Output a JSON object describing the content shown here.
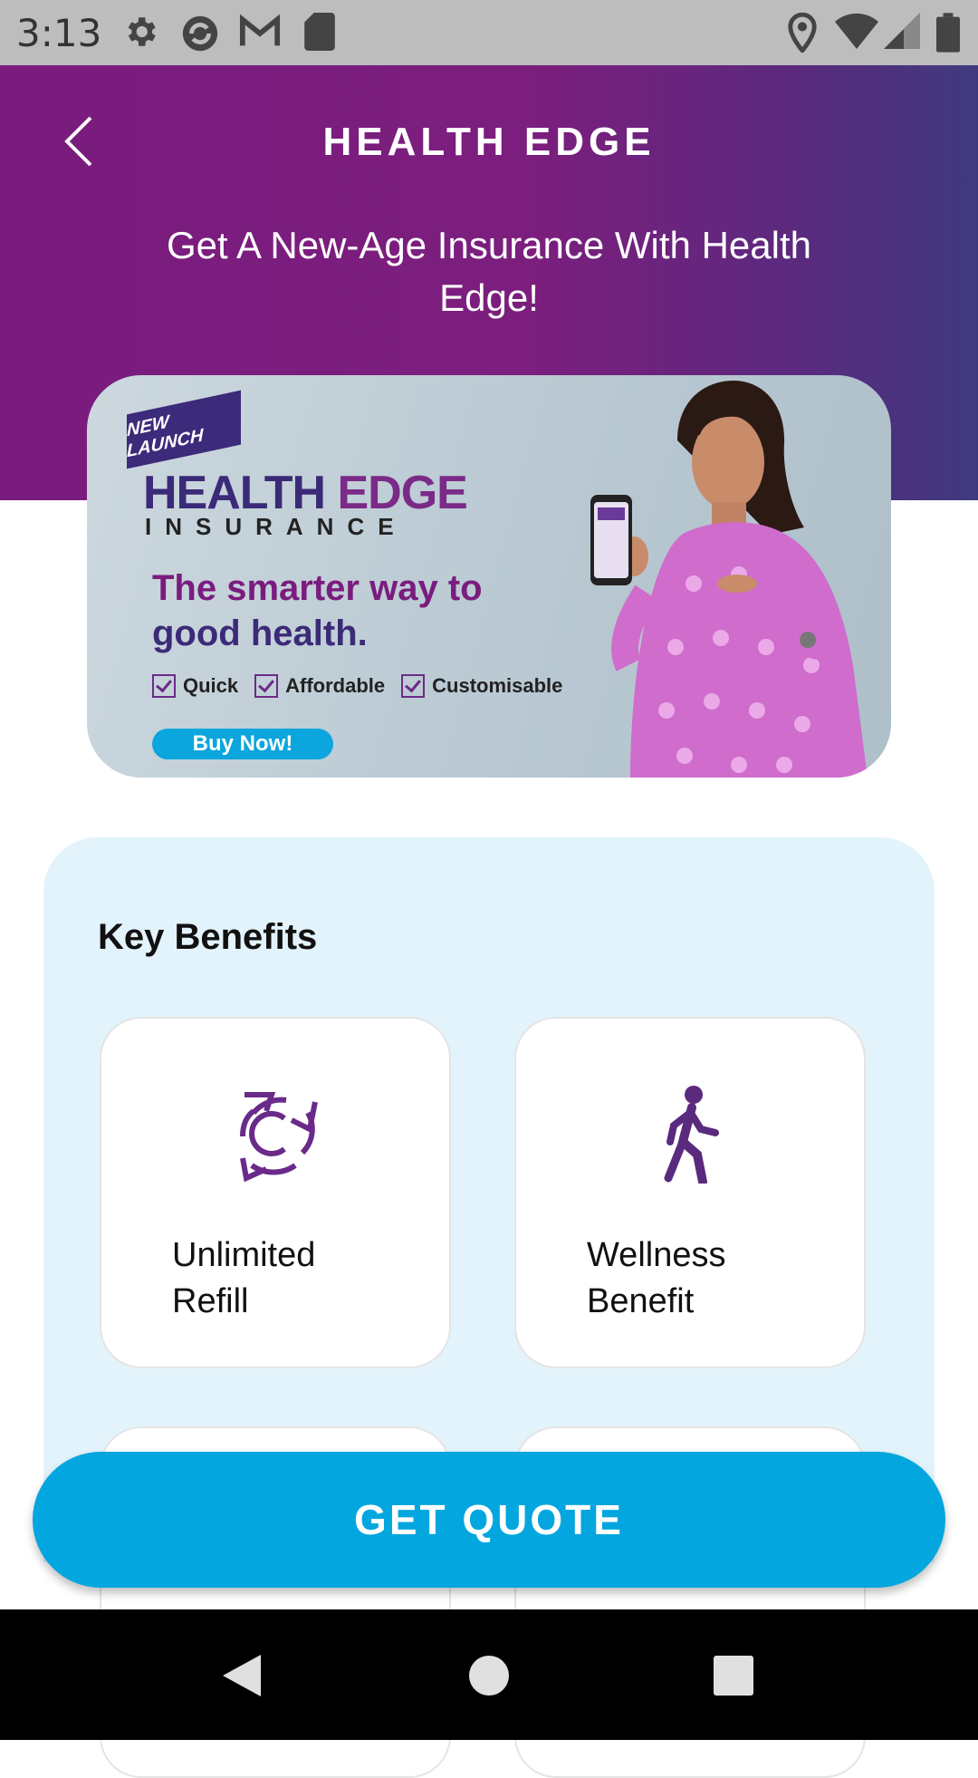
{
  "status_bar": {
    "time": "3:13",
    "left_icons": [
      "gear-icon",
      "sync-icon",
      "gmail-icon",
      "sd-card-icon"
    ],
    "right_icons": [
      "location-icon",
      "wifi-icon",
      "signal-icon",
      "battery-icon"
    ]
  },
  "header": {
    "title": "HEALTH EDGE",
    "subtitle": "Get A New-Age Insurance With Health Edge!",
    "gradient_colors": [
      "#7a1c7e",
      "#3f3a7e"
    ]
  },
  "banner": {
    "badge": "NEW LAUNCH",
    "brand": "HEALTH",
    "brand_accent": "EDGE",
    "brand_sub": "INSURANCE",
    "tagline_1": "The smarter way to",
    "tagline_2": "good health.",
    "features": [
      "Quick",
      "Affordable",
      "Customisable"
    ],
    "cta": "Buy Now!"
  },
  "benefits": {
    "heading": "Key Benefits",
    "items": [
      {
        "label": "Unlimited Refill",
        "icon": "refill-cycle-icon"
      },
      {
        "label": "Wellness Benefit",
        "icon": "walking-person-icon"
      }
    ]
  },
  "cta": {
    "label": "GET QUOTE",
    "color": "#03a6df"
  }
}
